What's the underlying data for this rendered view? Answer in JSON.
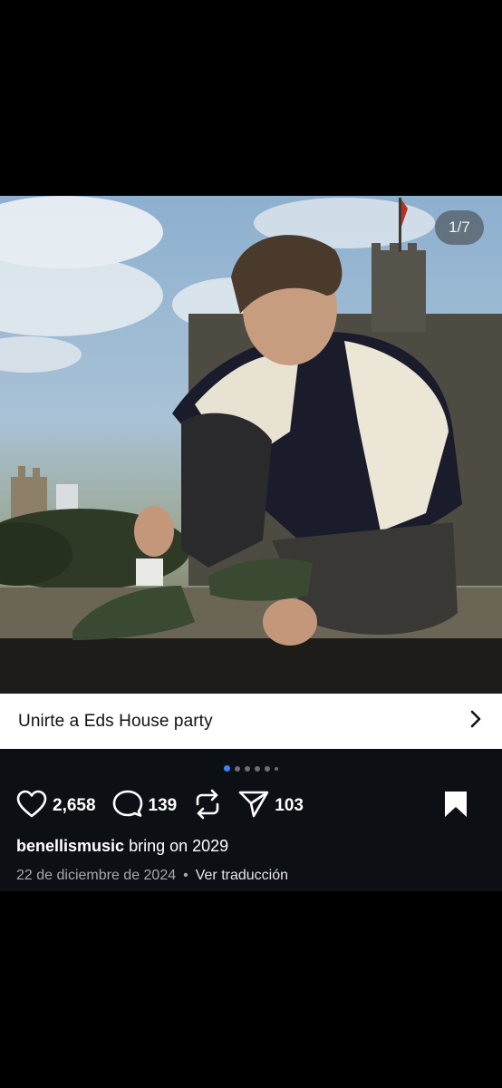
{
  "post": {
    "image_counter": "1/7",
    "party_label": "Unirte a Eds House party",
    "carousel": {
      "total_visible_dots": 6,
      "active_index": 0
    },
    "actions": {
      "likes": "2,658",
      "comments": "139",
      "shares": "103"
    },
    "caption": {
      "username": "benellismusic",
      "text": " bring on 2029"
    },
    "date": "22 de diciembre de 2024",
    "separator": "•",
    "translate_label": "Ver traducción"
  },
  "icons": {
    "like": "heart-icon",
    "comment": "comment-icon",
    "repost": "repost-icon",
    "share": "send-icon",
    "save": "bookmark-icon",
    "party_arrow": "chevron-right-icon"
  },
  "colors": {
    "background": "#000000",
    "post_bg": "#0c1014",
    "active_dot": "#3b82f6",
    "meta_text": "#a8a8a8"
  }
}
